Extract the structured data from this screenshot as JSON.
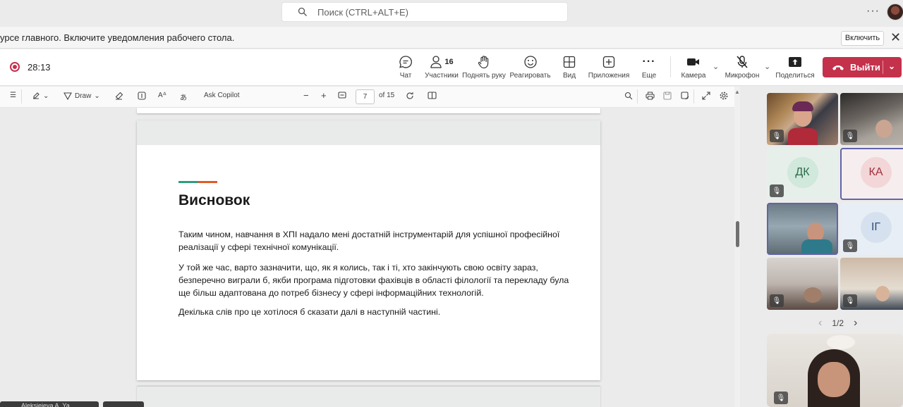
{
  "search": {
    "placeholder": "Поиск (CTRL+ALT+E)"
  },
  "top": {
    "more": "···"
  },
  "notification": {
    "text": "урсе главного. Включите уведомления рабочего стола.",
    "enable_label": "Включить",
    "close": "✕"
  },
  "meeting": {
    "timer": "28:13",
    "participants_count": "16",
    "tools": [
      {
        "label": "Чат"
      },
      {
        "label": "Участники"
      },
      {
        "label": "Поднять руку"
      },
      {
        "label": "Реагировать"
      },
      {
        "label": "Вид"
      },
      {
        "label": "Приложения"
      },
      {
        "label": "Еще"
      }
    ],
    "device_tools": [
      {
        "label": "Камера"
      },
      {
        "label": "Микрофон"
      },
      {
        "label": "Поделиться"
      }
    ],
    "leave_label": "Выйти"
  },
  "pdf": {
    "draw_label": "Draw",
    "copilot_label": "Ask Copilot",
    "current_page": "7",
    "page_total": "of 15"
  },
  "document": {
    "heading": "Висновок",
    "paragraphs": [
      "Таким чином, навчання в ХПІ надало мені достатній інструментарій для успішної професійної реалізації у сфері технічної комунікації.",
      "У той же час, варто зазначити, що, як я колись, так і ті, хто закінчують свою освіту зараз, безперечно виграли б, якби програма підготовки фахівців в області філології та перекладу була ще більш адаптована до потреб бізнесу у сфері інформаційних технологій.",
      "Декілька слів про це хотілося б сказати далі в наступній частині."
    ]
  },
  "gallery": {
    "initials": [
      "ДК",
      "КА",
      "ІГ"
    ],
    "pager": "1/2",
    "prev": "‹",
    "next": "›"
  },
  "taskbar": {
    "tab1": "Aleksieieva A. Ya",
    "tab2": "..."
  },
  "colors": {
    "leave": "#c4314b",
    "accent": "#6264a7",
    "green": "#2e9d7f",
    "orange": "#e35a27"
  }
}
